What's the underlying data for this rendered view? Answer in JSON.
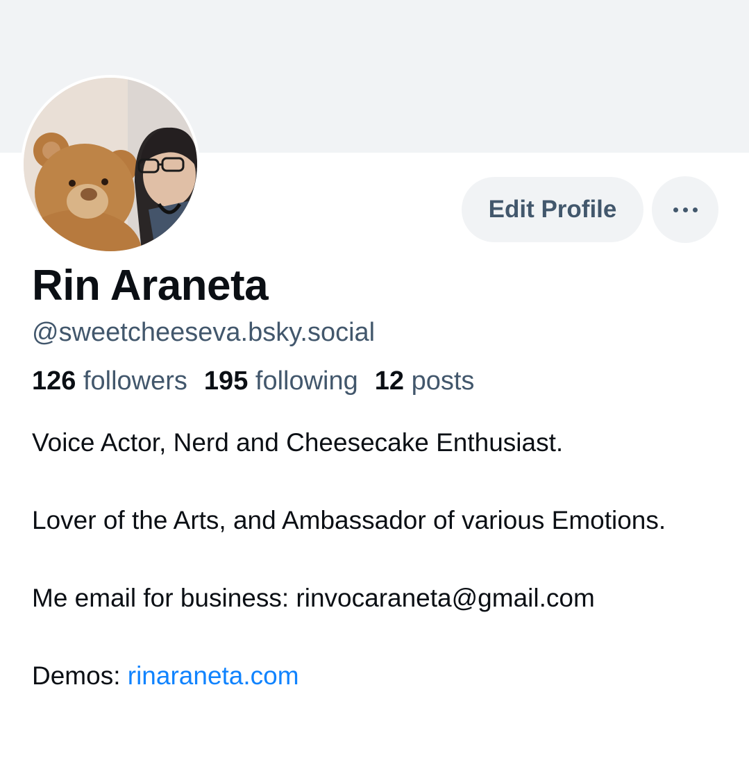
{
  "header": {
    "edit_profile_label": "Edit Profile"
  },
  "profile": {
    "display_name": "Rin Araneta",
    "handle": "@sweetcheeseva.bsky.social",
    "stats": {
      "followers_count": "126",
      "followers_label": "followers",
      "following_count": "195",
      "following_label": "following",
      "posts_count": "12",
      "posts_label": "posts"
    },
    "bio": {
      "line1": "Voice Actor, Nerd and Cheesecake Enthusiast.",
      "line2": "Lover of the Arts, and Ambassador of various Emotions.",
      "line3": "Me email for business: rinvocaraneta@gmail.com",
      "demos_prefix": "Demos: ",
      "demos_link": "rinaraneta.com"
    }
  },
  "icons": {
    "more": "more-horizontal-icon"
  },
  "colors": {
    "banner": "#f1f3f5",
    "text_primary": "#0b0f14",
    "text_secondary": "#42576c",
    "link": "#1083fe"
  }
}
